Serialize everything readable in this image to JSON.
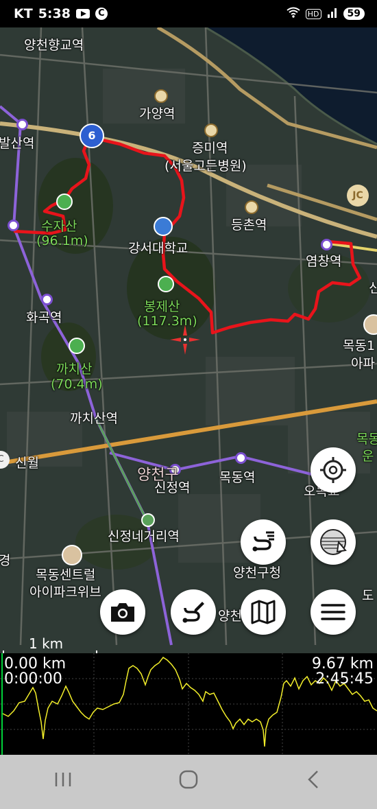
{
  "status": {
    "carrier": "KT",
    "time": "5:38",
    "hd": "HD",
    "battery": "59"
  },
  "map": {
    "labels": {
      "yangcheon_hyanggyo": "양천향교역",
      "gayang": "가양역",
      "jeungmi": "증미역",
      "seoul_hospital": "(서울고든병원)",
      "balsan": "발산역",
      "deungchon": "등촌역",
      "gangseo_univ": "강서대학교",
      "yeomchang": "염창역",
      "sujasan": "수자산",
      "sujasan_elev": "(96.1m)",
      "bongjesan": "봉제산",
      "bongjesan_elev": "(117.3m)",
      "hwagok": "화곡역",
      "kkachisan": "까치산",
      "kkachisan_elev": "(70.4m)",
      "kkachisan_station": "까치산역",
      "mokdong1": "목동1",
      "apa": "아파",
      "sinwol": "신월",
      "yangcheon_gu": "양천구",
      "sinjeong": "신정역",
      "mokdong_station": "목동역",
      "omokgyo": "오목교",
      "sinjeong_negeori": "신정네거리역",
      "yangcheon_office": "양천구청",
      "mokdong_central1": "목동센트럴",
      "mokdong_central2": "아이파크위브",
      "yang": "양천",
      "road_badge": "6",
      "jc_badge": "JC",
      "c_badge": "C",
      "edge_sin": "신",
      "edge_mok": "목동",
      "edge_un": "운",
      "edge_gyeong": "경",
      "edge_do": "도"
    },
    "scale_label": "1 km"
  },
  "track_summary": {
    "start_distance": "0.00 km",
    "start_time": "0:00:00",
    "end_distance": "9.67 km",
    "end_time": "2:45:45"
  },
  "colors": {
    "track": "#e8141b",
    "elevation": "#f3ef2a",
    "accent_line": "#00d23a"
  },
  "icons": [
    "crosshair-icon",
    "layers-icon",
    "route-list-icon",
    "camera-icon",
    "route-edit-icon",
    "map-icon",
    "menu-icon",
    "recent-apps-icon",
    "home-icon",
    "back-icon"
  ]
}
